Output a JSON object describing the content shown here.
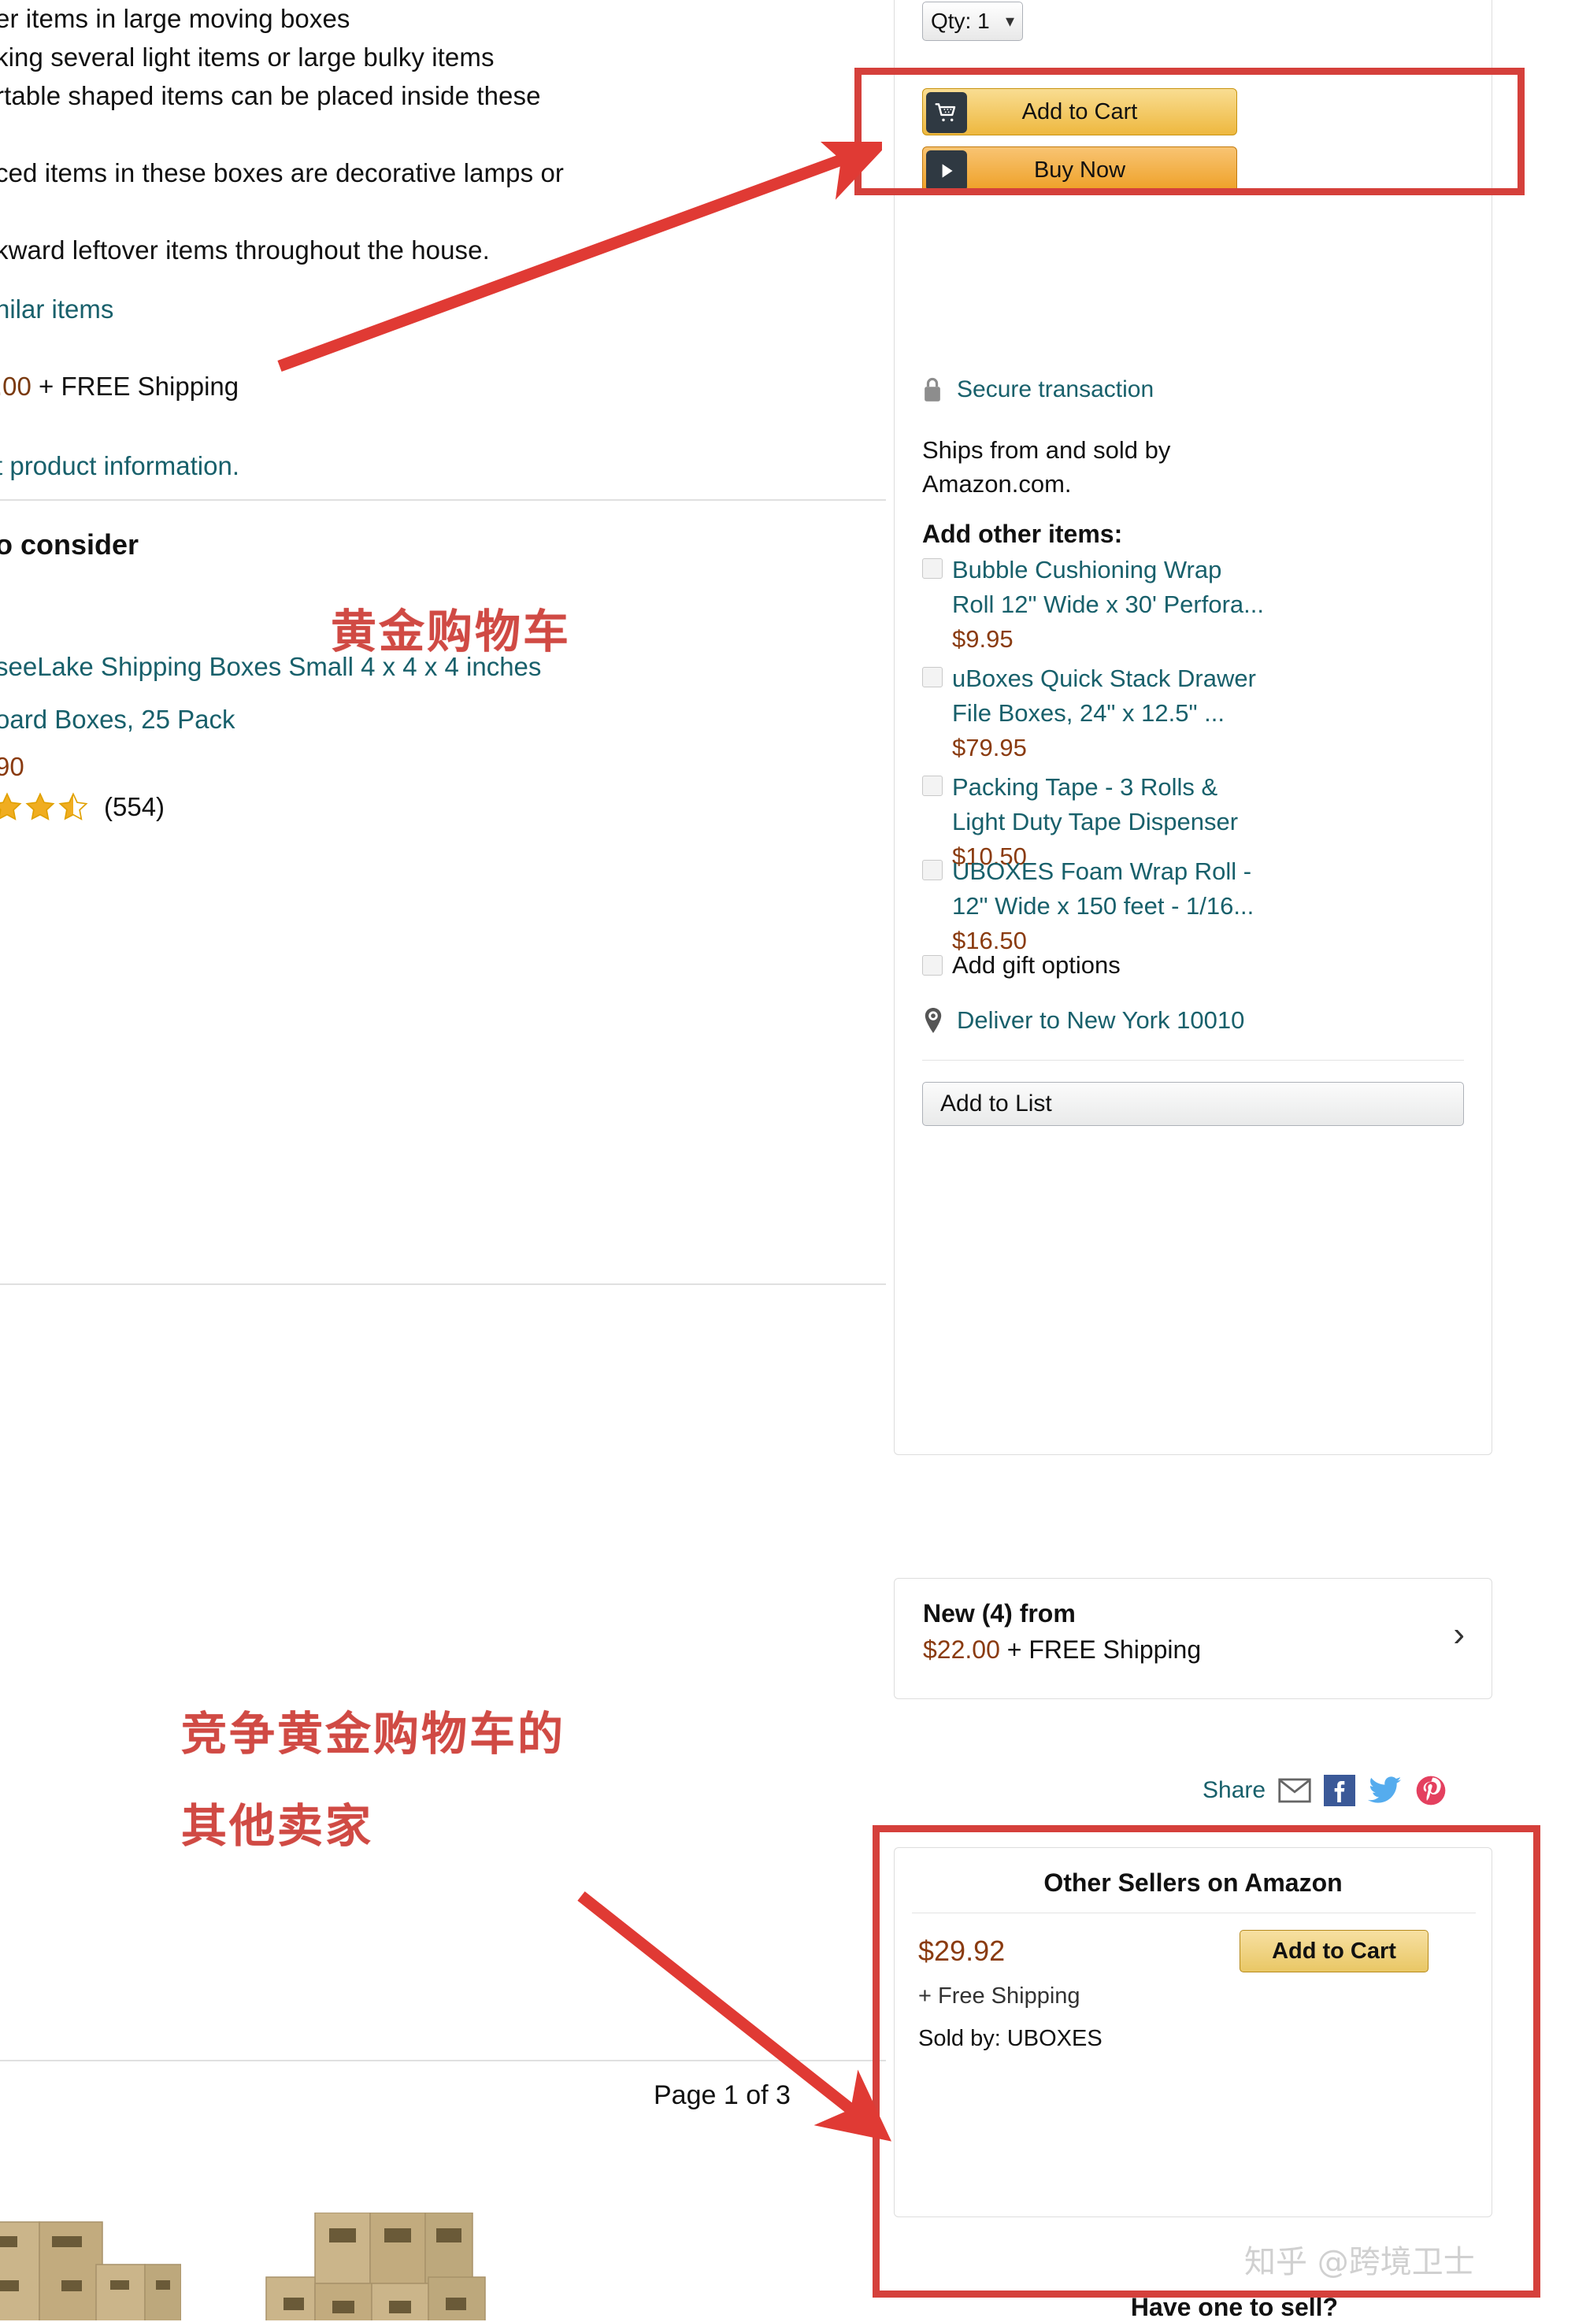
{
  "left": {
    "description_lines": [
      "er items in large moving boxes",
      "king several light items or large bulky items",
      "rtable shaped items can be placed inside these",
      "ced items in these boxes are decorative lamps or",
      "kward leftover items throughout the house."
    ],
    "similar_items_link": "nilar items",
    "price_shipping": {
      "amount": ".00",
      "rest": " + FREE Shipping"
    },
    "product_information_link": "t product information.",
    "consider_heading": "o consider",
    "product": {
      "title_line1": "seeLake Shipping Boxes Small 4 x 4 x 4 inches",
      "title_line2": "oard Boxes, 25 Pack",
      "price_fragment": "90",
      "rating_stars_filled": 2,
      "rating_stars_half": 1,
      "rating_stars_total": 5,
      "review_count": "(554)"
    },
    "page_indicator": "Page 1 of 3"
  },
  "annotations": {
    "buybox_label": "黄金购物车",
    "other_sellers_label_line1": "竞争黄金购物车的",
    "other_sellers_label_line2": "其他卖家",
    "box_color": "#d5403b",
    "arrow_color": "#e03a34",
    "text_color": "#d04a44"
  },
  "watermark": "知乎 @跨境卫士",
  "buybox": {
    "qty_label": "Qty:",
    "qty_value": "1",
    "add_to_cart_label": "Add to Cart",
    "buy_now_label": "Buy Now",
    "secure_transaction": "Secure transaction",
    "ships_sold_by": "Ships from and sold by Amazon.com.",
    "add_other_items_title": "Add other items:",
    "addon_items": [
      {
        "title": "Bubble Cushioning Wrap Roll 12\" Wide x 30' Perfora...",
        "price": "$9.95"
      },
      {
        "title": "uBoxes Quick Stack Drawer File Boxes, 24\" x 12.5\" ...",
        "price": "$79.95"
      },
      {
        "title": "Packing Tape - 3 Rolls & Light Duty Tape Dispenser",
        "price": "$10.50"
      },
      {
        "title": "UBOXES Foam Wrap Roll - 12\" Wide x 150 feet - 1/16...",
        "price": "$16.50"
      }
    ],
    "gift_options_label": "Add gift options",
    "deliver_to": "Deliver to New York 10010",
    "add_to_list_label": "Add to List"
  },
  "new_offers": {
    "title": "New (4) from",
    "price": "$22.00",
    "shipping": " + FREE Shipping"
  },
  "share": {
    "label": "Share",
    "icons": [
      "email-icon",
      "facebook-icon",
      "twitter-icon",
      "pinterest-icon"
    ]
  },
  "other_sellers": {
    "title": "Other Sellers on Amazon",
    "price": "$29.92",
    "shipping": "+ Free Shipping",
    "sold_by": "Sold by: UBOXES",
    "add_to_cart_label": "Add to Cart",
    "have_one_to_sell": "Have one to sell?"
  }
}
